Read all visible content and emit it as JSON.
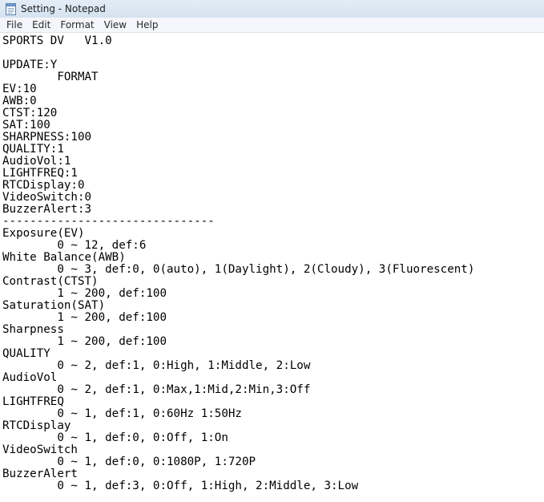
{
  "window": {
    "title": "Setting - Notepad",
    "icon": "notepad-icon"
  },
  "menu": {
    "items": [
      "File",
      "Edit",
      "Format",
      "View",
      "Help"
    ]
  },
  "editor": {
    "lines": [
      "SPORTS DV   V1.0",
      "",
      "UPDATE:Y",
      "\tFORMAT",
      "EV:10",
      "AWB:0",
      "CTST:120",
      "SAT:100",
      "SHARPNESS:100",
      "QUALITY:1",
      "AudioVol:1",
      "LIGHTFREQ:1",
      "RTCDisplay:0",
      "VideoSwitch:0",
      "BuzzerAlert:3",
      "-------------------------------",
      "Exposure(EV)",
      "\t0 ~ 12, def:6",
      "White Balance(AWB)",
      "\t0 ~ 3, def:0, 0(auto), 1(Daylight), 2(Cloudy), 3(Fluorescent)",
      "Contrast(CTST)",
      "\t1 ~ 200, def:100",
      "Saturation(SAT)",
      "\t1 ~ 200, def:100",
      "Sharpness",
      "\t1 ~ 200, def:100",
      "QUALITY",
      "\t0 ~ 2, def:1, 0:High, 1:Middle, 2:Low",
      "AudioVol",
      "\t0 ~ 2, def:1, 0:Max,1:Mid,2:Min,3:Off",
      "LIGHTFREQ",
      "\t0 ~ 1, def:1, 0:60Hz 1:50Hz",
      "RTCDisplay",
      "\t0 ~ 1, def:0, 0:Off, 1:On",
      "VideoSwitch",
      "\t0 ~ 1, def:0, 0:1080P, 1:720P",
      "BuzzerAlert",
      "\t0 ~ 1, def:3, 0:Off, 1:High, 2:Middle, 3:Low"
    ]
  }
}
